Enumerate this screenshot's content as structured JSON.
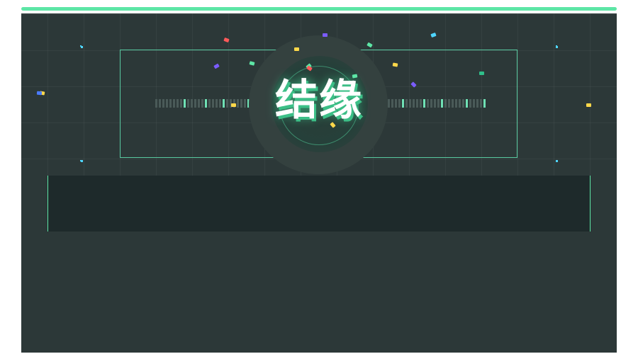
{
  "banner": {
    "title": "结缘"
  },
  "colors": {
    "page_bg": "#ffffff",
    "panel_bg": "#2c3838",
    "accent": "#5de6a6",
    "frame_line": "#58c9a0",
    "bottom_box_bg": "#1e2a2b",
    "bottom_box_edge": "#5de6a6",
    "title_text": "#ffffff",
    "title_shadow": "#3cbf87",
    "halo_outer": "#34413f",
    "halo_inner": "#2a3d37",
    "halo_ring": "#3d8a6c",
    "eq_dim": "#4a5a58",
    "eq_bright": "#6fe0b4",
    "spark": "#4fd6ff"
  },
  "confetti": [
    {
      "color": "#ff5a5a"
    },
    {
      "color": "#7b5cff"
    },
    {
      "color": "#5de6a6"
    },
    {
      "color": "#ffd84a"
    },
    {
      "color": "#4fd6ff"
    },
    {
      "color": "#5de6a6"
    },
    {
      "color": "#7b5cff"
    },
    {
      "color": "#ffd84a"
    },
    {
      "color": "#5de6a6"
    },
    {
      "color": "#4a7bff"
    },
    {
      "color": "#ffd84a"
    },
    {
      "color": "#ff5a5a"
    },
    {
      "color": "#5de6a6"
    },
    {
      "color": "#ffd84a"
    },
    {
      "color": "#2fbf8a"
    },
    {
      "color": "#ffd84a"
    },
    {
      "color": "#7b5cff"
    },
    {
      "color": "#ffd84a"
    }
  ]
}
